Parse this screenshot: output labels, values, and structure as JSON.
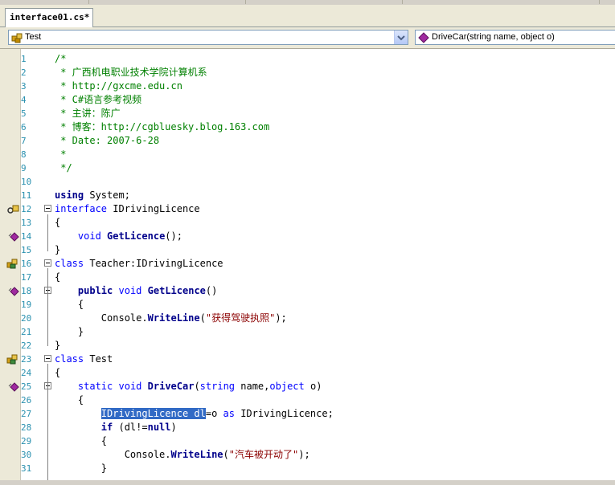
{
  "tabs": [
    {
      "label": "interface01.cs*"
    }
  ],
  "nav": {
    "type_combo": "Test",
    "member_combo": "DriveCar(string name, object o)"
  },
  "colors": {
    "keyword": "#0000ff",
    "comment": "#008000",
    "string": "#8b0000",
    "line_number": "#2b91af",
    "selection": "#316ac5"
  },
  "lines": [
    {
      "n": "1",
      "segs": [
        {
          "t": "/*",
          "c": "cm"
        }
      ]
    },
    {
      "n": "2",
      "segs": [
        {
          "t": " * 广西机电职业技术学院计算机系",
          "c": "cm"
        }
      ]
    },
    {
      "n": "3",
      "segs": [
        {
          "t": " * http://gxcme.edu.cn",
          "c": "cm"
        }
      ]
    },
    {
      "n": "4",
      "segs": [
        {
          "t": " * C#语言参考视频",
          "c": "cm"
        }
      ]
    },
    {
      "n": "5",
      "segs": [
        {
          "t": " * 主讲：陈广",
          "c": "cm"
        }
      ]
    },
    {
      "n": "6",
      "segs": [
        {
          "t": " * 博客：http://cgbluesky.blog.163.com",
          "c": "cm"
        }
      ]
    },
    {
      "n": "7",
      "segs": [
        {
          "t": " * Date: 2007-6-28",
          "c": "cm"
        }
      ]
    },
    {
      "n": "8",
      "segs": [
        {
          "t": " *",
          "c": "cm"
        }
      ]
    },
    {
      "n": "9",
      "segs": [
        {
          "t": " */",
          "c": "cm"
        }
      ]
    },
    {
      "n": "10",
      "segs": []
    },
    {
      "n": "11",
      "segs": [
        {
          "t": "using",
          "c": "kwb"
        },
        {
          "t": " System;",
          "c": ""
        }
      ]
    },
    {
      "n": "12",
      "segs": [
        {
          "t": "interface",
          "c": "kw"
        },
        {
          "t": " IDrivingLicence",
          "c": ""
        }
      ]
    },
    {
      "n": "13",
      "segs": [
        {
          "t": "{",
          "c": ""
        }
      ]
    },
    {
      "n": "14",
      "segs": [
        {
          "t": "    ",
          "c": ""
        },
        {
          "t": "void",
          "c": "kw"
        },
        {
          "t": " ",
          "c": ""
        },
        {
          "t": "GetLicence",
          "c": "mth"
        },
        {
          "t": "();",
          "c": ""
        }
      ]
    },
    {
      "n": "15",
      "segs": [
        {
          "t": "}",
          "c": ""
        }
      ]
    },
    {
      "n": "16",
      "segs": [
        {
          "t": "class",
          "c": "kw"
        },
        {
          "t": " Teacher:IDrivingLicence",
          "c": ""
        }
      ]
    },
    {
      "n": "17",
      "segs": [
        {
          "t": "{",
          "c": ""
        }
      ]
    },
    {
      "n": "18",
      "segs": [
        {
          "t": "    ",
          "c": ""
        },
        {
          "t": "public",
          "c": "kwb"
        },
        {
          "t": " ",
          "c": ""
        },
        {
          "t": "void",
          "c": "kw"
        },
        {
          "t": " ",
          "c": ""
        },
        {
          "t": "GetLicence",
          "c": "mth"
        },
        {
          "t": "()",
          "c": ""
        }
      ]
    },
    {
      "n": "19",
      "segs": [
        {
          "t": "    {",
          "c": ""
        }
      ]
    },
    {
      "n": "20",
      "segs": [
        {
          "t": "        Console.",
          "c": ""
        },
        {
          "t": "WriteLine",
          "c": "mth"
        },
        {
          "t": "(",
          "c": ""
        },
        {
          "t": "\"获得驾驶执照\"",
          "c": "str"
        },
        {
          "t": ");",
          "c": ""
        }
      ]
    },
    {
      "n": "21",
      "segs": [
        {
          "t": "    }",
          "c": ""
        }
      ]
    },
    {
      "n": "22",
      "segs": [
        {
          "t": "}",
          "c": ""
        }
      ]
    },
    {
      "n": "23",
      "segs": [
        {
          "t": "class",
          "c": "kw"
        },
        {
          "t": " Test",
          "c": ""
        }
      ]
    },
    {
      "n": "24",
      "segs": [
        {
          "t": "{",
          "c": ""
        }
      ]
    },
    {
      "n": "25",
      "segs": [
        {
          "t": "    ",
          "c": ""
        },
        {
          "t": "static",
          "c": "kw"
        },
        {
          "t": " ",
          "c": ""
        },
        {
          "t": "void",
          "c": "kw"
        },
        {
          "t": " ",
          "c": ""
        },
        {
          "t": "DriveCar",
          "c": "mth"
        },
        {
          "t": "(",
          "c": ""
        },
        {
          "t": "string",
          "c": "kw"
        },
        {
          "t": " name,",
          "c": ""
        },
        {
          "t": "object",
          "c": "kw"
        },
        {
          "t": " o)",
          "c": ""
        }
      ]
    },
    {
      "n": "26",
      "segs": [
        {
          "t": "    {",
          "c": ""
        }
      ]
    },
    {
      "n": "27",
      "segs": [
        {
          "t": "        ",
          "c": ""
        },
        {
          "t": "IDrivingLicence dl",
          "c": "sel"
        },
        {
          "t": "=o ",
          "c": ""
        },
        {
          "t": "as",
          "c": "kw"
        },
        {
          "t": " IDrivingLicence;",
          "c": ""
        }
      ]
    },
    {
      "n": "28",
      "segs": [
        {
          "t": "        ",
          "c": ""
        },
        {
          "t": "if",
          "c": "kwb"
        },
        {
          "t": " (dl!=",
          "c": ""
        },
        {
          "t": "null",
          "c": "kwb"
        },
        {
          "t": ")",
          "c": ""
        }
      ]
    },
    {
      "n": "29",
      "segs": [
        {
          "t": "        {",
          "c": ""
        }
      ]
    },
    {
      "n": "30",
      "segs": [
        {
          "t": "            Console.",
          "c": ""
        },
        {
          "t": "WriteLine",
          "c": "mth"
        },
        {
          "t": "(",
          "c": ""
        },
        {
          "t": "\"汽车被开动了\"",
          "c": "str"
        },
        {
          "t": ");",
          "c": ""
        }
      ]
    },
    {
      "n": "31",
      "segs": [
        {
          "t": "        }",
          "c": ""
        }
      ]
    }
  ]
}
